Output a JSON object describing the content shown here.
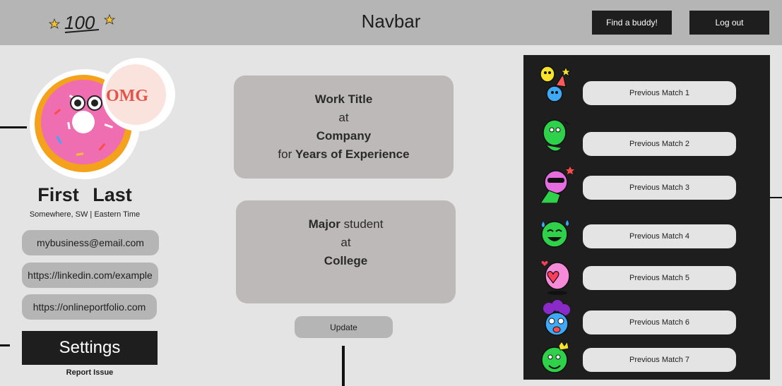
{
  "navbar": {
    "logo_text": "100",
    "title": "Navbar",
    "find_buddy_label": "Find a buddy!",
    "logout_label": "Log out"
  },
  "profile": {
    "avatar_text": "OMG",
    "first_name": "First",
    "last_name": "Last",
    "location": "Somewhere, SW | Eastern Time",
    "email": "mybusiness@email.com",
    "linkedin": "https://linkedin.com/example",
    "portfolio": "https://onlineportfolio.com",
    "settings_label": "Settings",
    "report_label": "Report Issue"
  },
  "work_card": {
    "title": "Work Title",
    "at1": "at",
    "company": "Company",
    "for_text": "for",
    "years": "Years of Experience"
  },
  "study_card": {
    "major": "Major",
    "student": "student",
    "at": "at",
    "college": "College"
  },
  "update_label": "Update",
  "matches": [
    {
      "label": "Previous Match 1",
      "sticker": "balloon-party-icon"
    },
    {
      "label": "Previous Match 2",
      "sticker": "green-thinking-icon"
    },
    {
      "label": "Previous Match 3",
      "sticker": "cool-sunglasses-icon"
    },
    {
      "label": "Previous Match 4",
      "sticker": "laughing-tears-icon"
    },
    {
      "label": "Previous Match 5",
      "sticker": "pink-heart-icon"
    },
    {
      "label": "Previous Match 6",
      "sticker": "shocked-blue-icon"
    },
    {
      "label": "Previous Match 7",
      "sticker": "green-crown-icon"
    }
  ],
  "colors": {
    "navbar_bg": "#b5b5b5",
    "page_bg": "#e4e4e4",
    "dark": "#1e1e1e",
    "card_bg": "#bdb9b8"
  }
}
